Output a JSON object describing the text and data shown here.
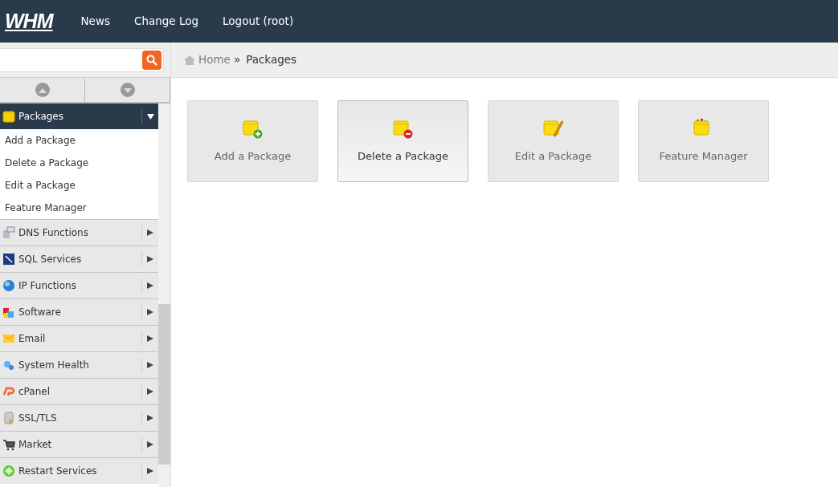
{
  "topbar": {
    "logo": "WHM",
    "links": [
      "News",
      "Change Log",
      "Logout (root)"
    ]
  },
  "breadcrumb": {
    "home": "Home",
    "separator": "»",
    "current": "Packages"
  },
  "sidebar": {
    "open_group": {
      "label": "Packages",
      "expanded": true,
      "items": [
        "Add a Package",
        "Delete a Package",
        "Edit a Package",
        "Feature Manager"
      ]
    },
    "groups": [
      {
        "label": "DNS Functions",
        "kind": "dns"
      },
      {
        "label": "SQL Services",
        "kind": "sql"
      },
      {
        "label": "IP Functions",
        "kind": "ip"
      },
      {
        "label": "Software",
        "kind": "software"
      },
      {
        "label": "Email",
        "kind": "email"
      },
      {
        "label": "System Health",
        "kind": "health"
      },
      {
        "label": "cPanel",
        "kind": "cpanel"
      },
      {
        "label": "SSL/TLS",
        "kind": "ssl"
      },
      {
        "label": "Market",
        "kind": "market"
      },
      {
        "label": "Restart Services",
        "kind": "restart"
      }
    ]
  },
  "tiles": [
    {
      "label": "Add a Package",
      "kind": "add",
      "hovered": false
    },
    {
      "label": "Delete a Package",
      "kind": "delete",
      "hovered": true
    },
    {
      "label": "Edit a Package",
      "kind": "edit",
      "hovered": false
    },
    {
      "label": "Feature Manager",
      "kind": "features",
      "hovered": false
    }
  ]
}
